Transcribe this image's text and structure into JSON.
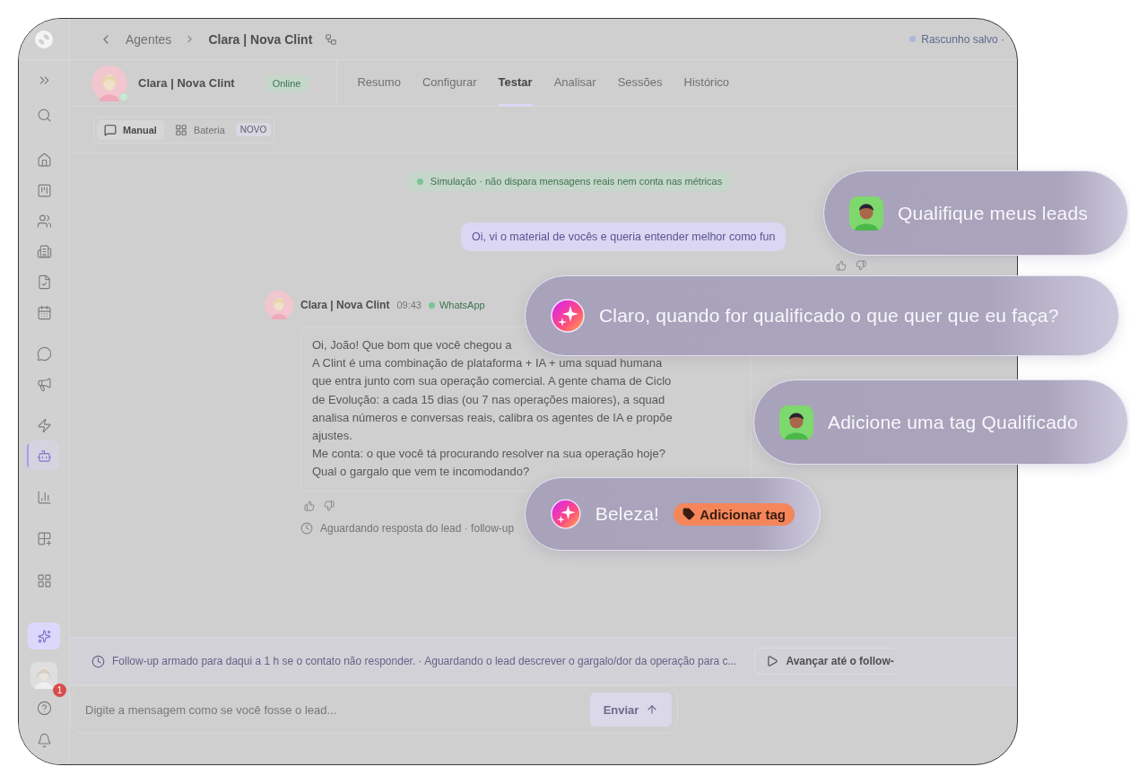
{
  "breadcrumb": {
    "parent": "Agentes",
    "current": "Clara | Nova Clint"
  },
  "save_status": "Rascunho salvo ·",
  "sidebar": {
    "items": [
      {
        "selected": false
      },
      {
        "selected": false
      },
      {
        "selected": false
      },
      {
        "selected": false
      },
      {
        "selected": false
      },
      {
        "selected": false
      },
      {
        "selected": false
      },
      {
        "selected": false
      },
      {
        "selected": false
      },
      {
        "selected": false
      },
      {
        "selected": false
      },
      {
        "selected": true
      },
      {
        "selected": false
      },
      {
        "selected": false
      },
      {
        "selected": false
      }
    ],
    "notification_badge": "1"
  },
  "agent": {
    "name": "Clara | Nova Clint",
    "status": "Online"
  },
  "tabs": [
    {
      "label": "Resumo",
      "selected": false
    },
    {
      "label": "Configurar",
      "selected": false
    },
    {
      "label": "Testar",
      "selected": true
    },
    {
      "label": "Analisar",
      "selected": false
    },
    {
      "label": "Sessões",
      "selected": false
    },
    {
      "label": "Histórico",
      "selected": false
    }
  ],
  "modes": [
    {
      "label": "Manual",
      "selected": true
    },
    {
      "label": "Bateria",
      "selected": false,
      "badge": "NOVO"
    }
  ],
  "chat": {
    "notice": "Simulação · não dispara mensagens reais nem conta nas métricas",
    "user_message": "Oi, vi o material de vocês e queria entender melhor como fun",
    "agent_message": {
      "name": "Clara | Nova Clint",
      "time": "09:43",
      "channel": "WhatsApp",
      "text": "Oi, João! Que bom que você chegou a\nA Clint é uma combinação de plataforma + IA + uma squad humana\nque entra junto com sua operação comercial. A gente chama de Ciclo\nde Evolução: a cada 15 dias (ou 7 nas operações maiores), a squad\nanalisa números e conversas reais, calibra os agentes de IA e propõe\najustes.\nMe conta: o que você tá procurando resolver na sua operação hoje?\nQual o gargalo que vem te incomodando?"
    },
    "waiting": "Aguardando resposta do lead · follow-up"
  },
  "followup_bar": {
    "text": "Follow-up armado para daqui a 1 h se o contato não responder. · Aguardando o lead descrever o gargalo/dor da operação para c...",
    "button": "Avançar até o follow-"
  },
  "composer": {
    "placeholder": "Digite a mensagem como se você fosse o lead...",
    "send": "Enviar"
  },
  "overlay_bubbles": [
    {
      "kind": "user",
      "text": "Qualifique meus leads"
    },
    {
      "kind": "assistant",
      "text": "Claro, quando for qualificado o que quer que eu faça?"
    },
    {
      "kind": "user",
      "text": "Adicione uma tag Qualificado"
    },
    {
      "kind": "assistant",
      "text": "Beleza!",
      "action": "Adicionar tag"
    }
  ]
}
